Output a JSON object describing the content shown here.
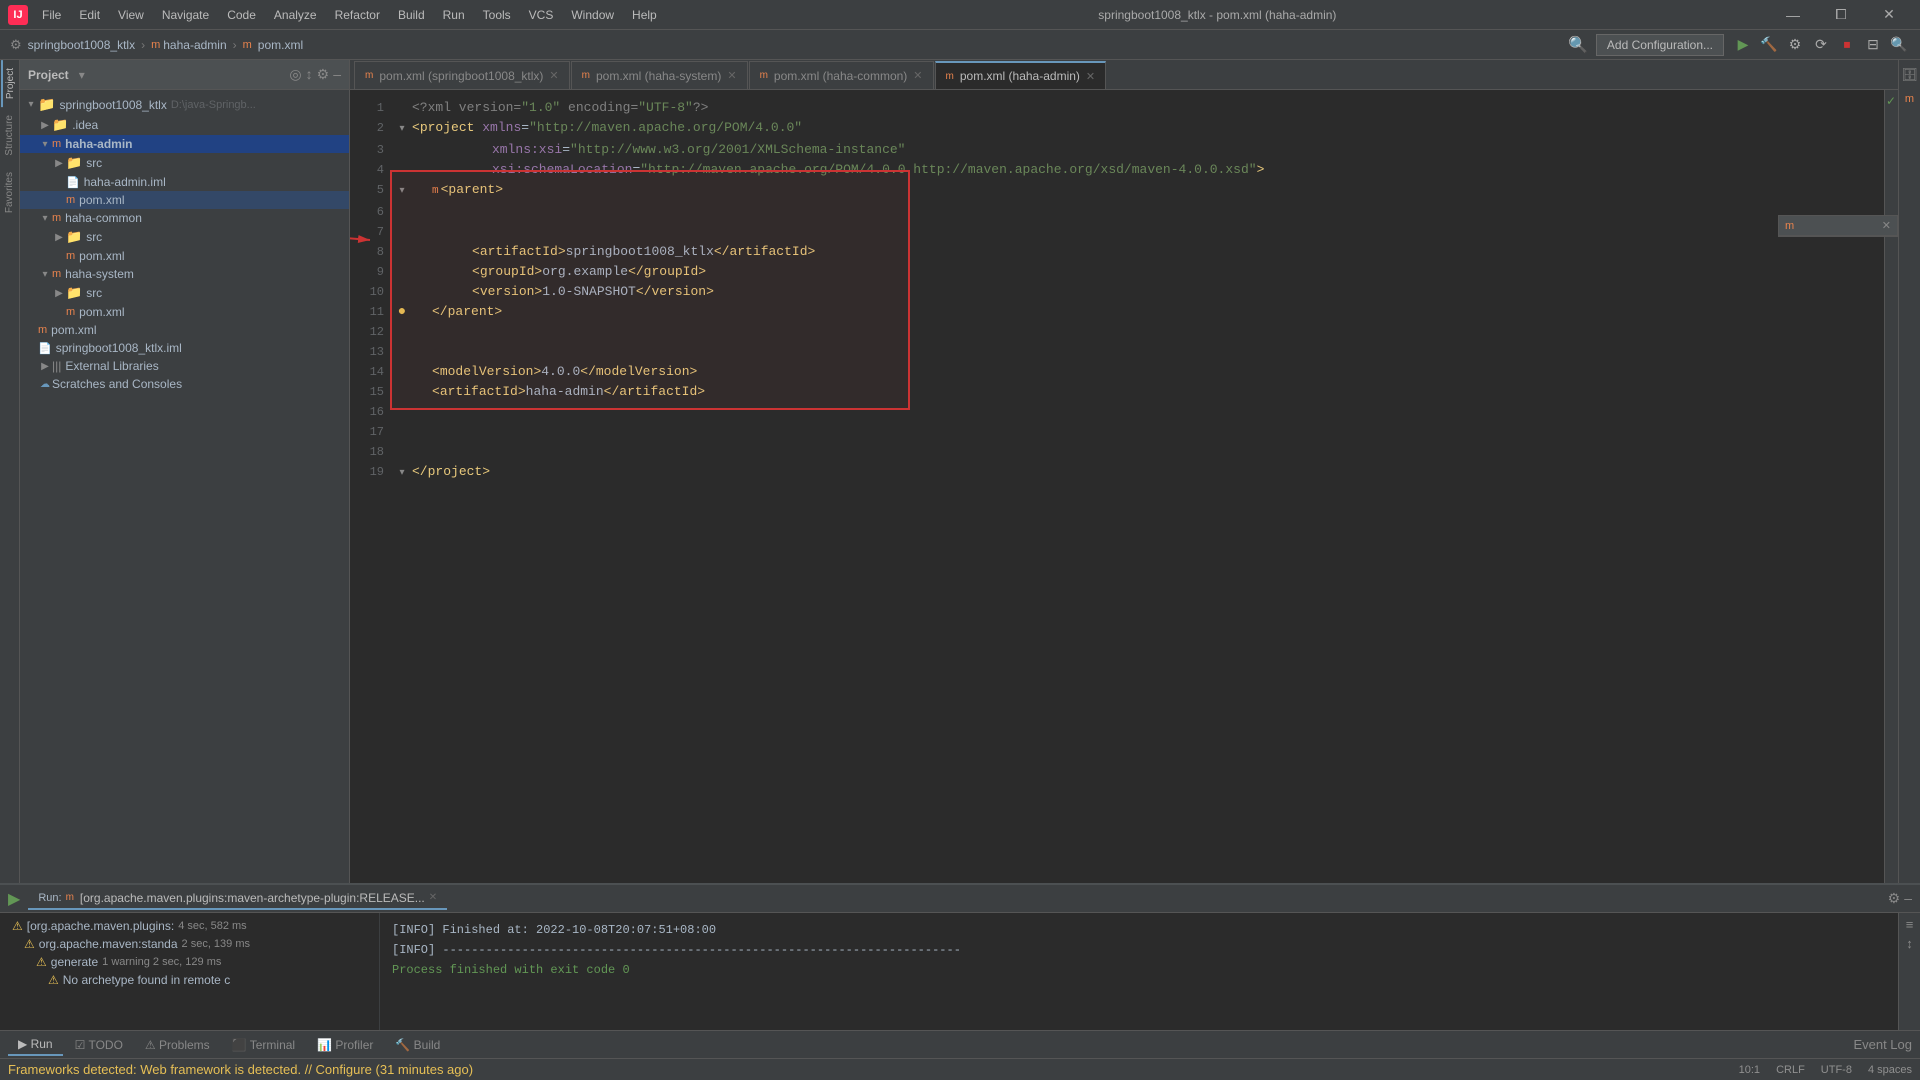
{
  "titlebar": {
    "logo": "IJ",
    "menu": [
      "File",
      "Edit",
      "View",
      "Navigate",
      "Code",
      "Analyze",
      "Refactor",
      "Build",
      "Run",
      "Tools",
      "VCS",
      "Window",
      "Help"
    ],
    "center": "springboot1008_ktlx - pom.xml (haha-admin)",
    "win_buttons": [
      "—",
      "⧠",
      "✕"
    ]
  },
  "navbar": {
    "breadcrumb": [
      "springboot1008_ktlx",
      "haha-admin",
      "pom.xml"
    ],
    "add_config": "Add Configuration...",
    "toolbar_icons": [
      "▶",
      "⚙",
      "⟳",
      "⏹"
    ]
  },
  "project_panel": {
    "title": "Project",
    "tree": [
      {
        "id": "root",
        "label": "springboot1008_ktlx",
        "extra": "D:\\java-Springb...",
        "indent": 0,
        "type": "project",
        "expanded": true
      },
      {
        "id": "idea",
        "label": ".idea",
        "indent": 1,
        "type": "folder",
        "expanded": false
      },
      {
        "id": "haha-admin",
        "label": "haha-admin",
        "indent": 1,
        "type": "module",
        "expanded": true,
        "active": true
      },
      {
        "id": "src",
        "label": "src",
        "indent": 2,
        "type": "folder",
        "expanded": false
      },
      {
        "id": "haha-admin.iml",
        "label": "haha-admin.iml",
        "indent": 2,
        "type": "iml"
      },
      {
        "id": "pom-admin",
        "label": "pom.xml",
        "indent": 2,
        "type": "xml",
        "selected": true
      },
      {
        "id": "haha-common",
        "label": "haha-common",
        "indent": 1,
        "type": "module",
        "expanded": true
      },
      {
        "id": "src2",
        "label": "src",
        "indent": 2,
        "type": "folder",
        "expanded": false
      },
      {
        "id": "pom-common",
        "label": "pom.xml",
        "indent": 2,
        "type": "xml"
      },
      {
        "id": "haha-system",
        "label": "haha-system",
        "indent": 1,
        "type": "module",
        "expanded": true
      },
      {
        "id": "src3",
        "label": "src",
        "indent": 2,
        "type": "folder",
        "expanded": false
      },
      {
        "id": "pom-system",
        "label": "pom.xml",
        "indent": 2,
        "type": "xml"
      },
      {
        "id": "pom-root",
        "label": "pom.xml",
        "indent": 1,
        "type": "xml"
      },
      {
        "id": "springboot.iml",
        "label": "springboot1008_ktlx.iml",
        "indent": 1,
        "type": "iml"
      },
      {
        "id": "ext-libs",
        "label": "External Libraries",
        "indent": 1,
        "type": "libs",
        "expanded": false
      },
      {
        "id": "scratches",
        "label": "Scratches and Consoles",
        "indent": 1,
        "type": "scratches"
      }
    ]
  },
  "editor_tabs": [
    {
      "label": "pom.xml (springboot1008_ktlx)",
      "active": false
    },
    {
      "label": "pom.xml (haha-system)",
      "active": false
    },
    {
      "label": "pom.xml (haha-common)",
      "active": false
    },
    {
      "label": "pom.xml (haha-admin)",
      "active": true
    }
  ],
  "editor": {
    "lines": [
      {
        "n": 1,
        "gutter": "",
        "code": "<?xml version=\"1.0\" encoding=\"UTF-8\"?>"
      },
      {
        "n": 2,
        "gutter": "▾",
        "code": "<project xmlns=\"http://maven.apache.org/POM/4.0.0\""
      },
      {
        "n": 3,
        "gutter": "",
        "code": "         xmlns:xsi=\"http://www.w3.org/2001/XMLSchema-instance\""
      },
      {
        "n": 4,
        "gutter": "",
        "code": "         xsi:schemaLocation=\"http://maven.apache.org/POM/4.0.0 http://maven.apache.org/xsd/maven-4.0.0.xsd\">"
      },
      {
        "n": 5,
        "gutter": "▾",
        "code": "    <parent>"
      },
      {
        "n": 6,
        "gutter": "",
        "code": ""
      },
      {
        "n": 7,
        "gutter": "",
        "code": ""
      },
      {
        "n": 8,
        "gutter": "",
        "code": "        <artifactId>springboot1008_ktlx</artifactId>"
      },
      {
        "n": 9,
        "gutter": "",
        "code": "        <groupId>org.example</groupId>"
      },
      {
        "n": 10,
        "gutter": "",
        "code": "        <version>1.0-SNAPSHOT</version>"
      },
      {
        "n": 11,
        "gutter": "◉",
        "code": "    </parent>"
      },
      {
        "n": 12,
        "gutter": "",
        "code": ""
      },
      {
        "n": 13,
        "gutter": "",
        "code": ""
      },
      {
        "n": 14,
        "gutter": "",
        "code": "    <modelVersion>4.0.0</modelVersion>"
      },
      {
        "n": 15,
        "gutter": "",
        "code": "    <artifactId>haha-admin</artifactId>"
      },
      {
        "n": 16,
        "gutter": "",
        "code": ""
      },
      {
        "n": 17,
        "gutter": "",
        "code": ""
      },
      {
        "n": 18,
        "gutter": "",
        "code": ""
      },
      {
        "n": 19,
        "gutter": "▾",
        "code": "</project>"
      }
    ]
  },
  "bottom_panel": {
    "run_label": "Run:",
    "run_tab": "[org.apache.maven.plugins:maven-archetype-plugin:RELEASE...",
    "tree_items": [
      {
        "label": "[org.apache.maven.plugins:",
        "time": "4 sec, 582 ms",
        "warn": true,
        "indent": 0
      },
      {
        "label": "org.apache.maven:standa",
        "time": "2 sec, 139 ms",
        "warn": true,
        "indent": 1
      },
      {
        "label": "generate",
        "extra": "1 warning   2 sec, 129 ms",
        "warn": true,
        "indent": 2
      },
      {
        "label": "No archetype found in remote c",
        "indent": 3,
        "warn": true
      }
    ],
    "output": [
      "[INFO] Finished at: 2022-10-08T20:07:51+08:00",
      "[INFO] ------------------------------------------------------------------------",
      "",
      "Process finished with exit code 0"
    ],
    "bottom_tabs": [
      "Run",
      "TODO",
      "Problems",
      "Terminal",
      "Profiler",
      "Build"
    ]
  },
  "statusbar": {
    "framework": "Frameworks detected: Web framework is detected. // Configure (31 minutes ago)",
    "position": "10:1",
    "encoding": "CRLF",
    "charset": "UTF-8",
    "indent": "4 spaces",
    "event_log": "Event Log"
  }
}
